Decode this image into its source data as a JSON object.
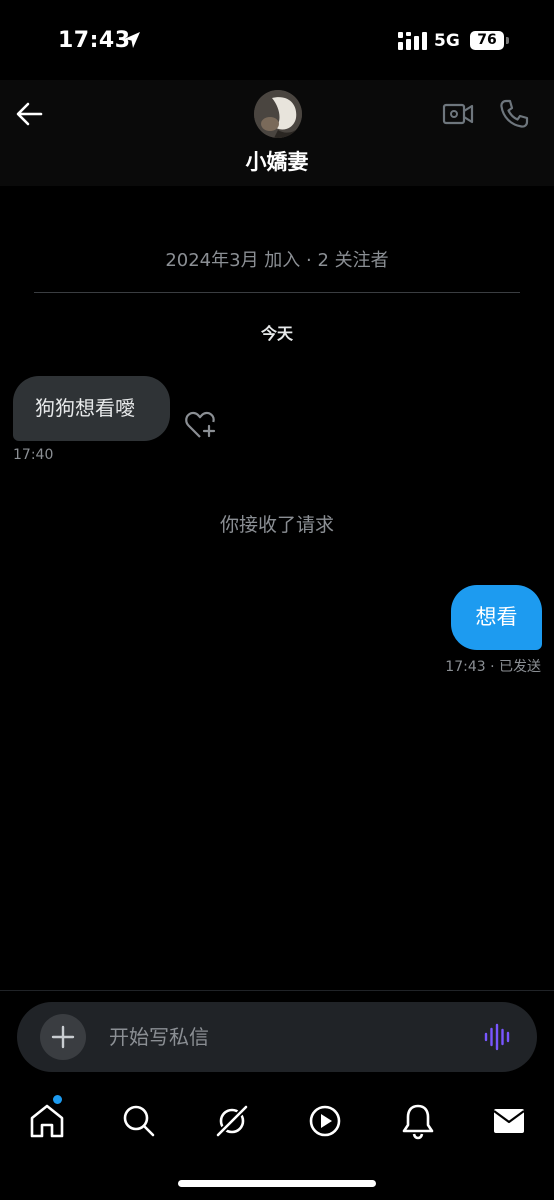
{
  "status_bar": {
    "time": "17:43",
    "network": "5G",
    "battery": "76",
    "icons": [
      "location-arrow-icon",
      "signal-bars-icon",
      "battery-icon"
    ]
  },
  "header": {
    "title": "小嬌妻",
    "icons": [
      "back-arrow-icon",
      "avatar",
      "video-call-icon",
      "phone-icon"
    ]
  },
  "conversation": {
    "joined_info": "2024年3月 加入 · 2 关注者",
    "day_label": "今天",
    "incoming": {
      "text": "狗狗想看噯",
      "time": "17:40"
    },
    "system_note": "你接收了请求",
    "outgoing": {
      "text": "想看",
      "time": "17:43 · 已发送"
    }
  },
  "composer": {
    "placeholder": "开始写私信",
    "icons": [
      "plus-icon",
      "voice-message-icon"
    ]
  },
  "bottom_nav": {
    "items": [
      "home",
      "search",
      "grok",
      "video",
      "notifications",
      "messages"
    ],
    "colors": {
      "accent": "#1d9bf0",
      "voice": "#7856ff"
    }
  }
}
